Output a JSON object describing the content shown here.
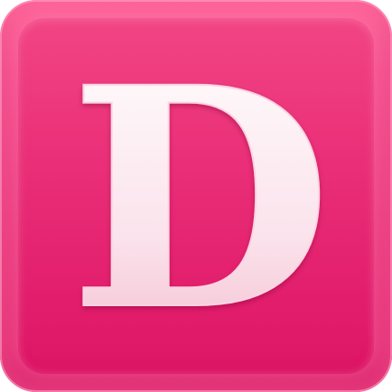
{
  "icon": {
    "letter": "D",
    "name": "letter-d-app-icon",
    "colors": {
      "background_top": "#ff5f93",
      "background_bottom": "#e11a69",
      "letter_top": "#ffffff",
      "letter_bottom": "#f2b9cc"
    }
  }
}
